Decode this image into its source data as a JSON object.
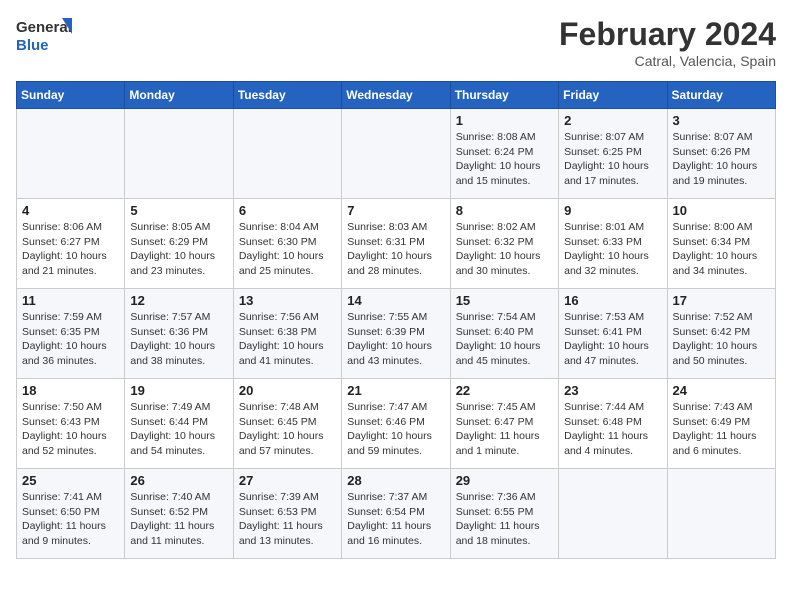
{
  "header": {
    "logo_line1": "General",
    "logo_line2": "Blue",
    "title": "February 2024",
    "subtitle": "Catral, Valencia, Spain"
  },
  "days_of_week": [
    "Sunday",
    "Monday",
    "Tuesday",
    "Wednesday",
    "Thursday",
    "Friday",
    "Saturday"
  ],
  "weeks": [
    [
      {
        "num": "",
        "content": ""
      },
      {
        "num": "",
        "content": ""
      },
      {
        "num": "",
        "content": ""
      },
      {
        "num": "",
        "content": ""
      },
      {
        "num": "1",
        "content": "Sunrise: 8:08 AM\nSunset: 6:24 PM\nDaylight: 10 hours\nand 15 minutes."
      },
      {
        "num": "2",
        "content": "Sunrise: 8:07 AM\nSunset: 6:25 PM\nDaylight: 10 hours\nand 17 minutes."
      },
      {
        "num": "3",
        "content": "Sunrise: 8:07 AM\nSunset: 6:26 PM\nDaylight: 10 hours\nand 19 minutes."
      }
    ],
    [
      {
        "num": "4",
        "content": "Sunrise: 8:06 AM\nSunset: 6:27 PM\nDaylight: 10 hours\nand 21 minutes."
      },
      {
        "num": "5",
        "content": "Sunrise: 8:05 AM\nSunset: 6:29 PM\nDaylight: 10 hours\nand 23 minutes."
      },
      {
        "num": "6",
        "content": "Sunrise: 8:04 AM\nSunset: 6:30 PM\nDaylight: 10 hours\nand 25 minutes."
      },
      {
        "num": "7",
        "content": "Sunrise: 8:03 AM\nSunset: 6:31 PM\nDaylight: 10 hours\nand 28 minutes."
      },
      {
        "num": "8",
        "content": "Sunrise: 8:02 AM\nSunset: 6:32 PM\nDaylight: 10 hours\nand 30 minutes."
      },
      {
        "num": "9",
        "content": "Sunrise: 8:01 AM\nSunset: 6:33 PM\nDaylight: 10 hours\nand 32 minutes."
      },
      {
        "num": "10",
        "content": "Sunrise: 8:00 AM\nSunset: 6:34 PM\nDaylight: 10 hours\nand 34 minutes."
      }
    ],
    [
      {
        "num": "11",
        "content": "Sunrise: 7:59 AM\nSunset: 6:35 PM\nDaylight: 10 hours\nand 36 minutes."
      },
      {
        "num": "12",
        "content": "Sunrise: 7:57 AM\nSunset: 6:36 PM\nDaylight: 10 hours\nand 38 minutes."
      },
      {
        "num": "13",
        "content": "Sunrise: 7:56 AM\nSunset: 6:38 PM\nDaylight: 10 hours\nand 41 minutes."
      },
      {
        "num": "14",
        "content": "Sunrise: 7:55 AM\nSunset: 6:39 PM\nDaylight: 10 hours\nand 43 minutes."
      },
      {
        "num": "15",
        "content": "Sunrise: 7:54 AM\nSunset: 6:40 PM\nDaylight: 10 hours\nand 45 minutes."
      },
      {
        "num": "16",
        "content": "Sunrise: 7:53 AM\nSunset: 6:41 PM\nDaylight: 10 hours\nand 47 minutes."
      },
      {
        "num": "17",
        "content": "Sunrise: 7:52 AM\nSunset: 6:42 PM\nDaylight: 10 hours\nand 50 minutes."
      }
    ],
    [
      {
        "num": "18",
        "content": "Sunrise: 7:50 AM\nSunset: 6:43 PM\nDaylight: 10 hours\nand 52 minutes."
      },
      {
        "num": "19",
        "content": "Sunrise: 7:49 AM\nSunset: 6:44 PM\nDaylight: 10 hours\nand 54 minutes."
      },
      {
        "num": "20",
        "content": "Sunrise: 7:48 AM\nSunset: 6:45 PM\nDaylight: 10 hours\nand 57 minutes."
      },
      {
        "num": "21",
        "content": "Sunrise: 7:47 AM\nSunset: 6:46 PM\nDaylight: 10 hours\nand 59 minutes."
      },
      {
        "num": "22",
        "content": "Sunrise: 7:45 AM\nSunset: 6:47 PM\nDaylight: 11 hours\nand 1 minute."
      },
      {
        "num": "23",
        "content": "Sunrise: 7:44 AM\nSunset: 6:48 PM\nDaylight: 11 hours\nand 4 minutes."
      },
      {
        "num": "24",
        "content": "Sunrise: 7:43 AM\nSunset: 6:49 PM\nDaylight: 11 hours\nand 6 minutes."
      }
    ],
    [
      {
        "num": "25",
        "content": "Sunrise: 7:41 AM\nSunset: 6:50 PM\nDaylight: 11 hours\nand 9 minutes."
      },
      {
        "num": "26",
        "content": "Sunrise: 7:40 AM\nSunset: 6:52 PM\nDaylight: 11 hours\nand 11 minutes."
      },
      {
        "num": "27",
        "content": "Sunrise: 7:39 AM\nSunset: 6:53 PM\nDaylight: 11 hours\nand 13 minutes."
      },
      {
        "num": "28",
        "content": "Sunrise: 7:37 AM\nSunset: 6:54 PM\nDaylight: 11 hours\nand 16 minutes."
      },
      {
        "num": "29",
        "content": "Sunrise: 7:36 AM\nSunset: 6:55 PM\nDaylight: 11 hours\nand 18 minutes."
      },
      {
        "num": "",
        "content": ""
      },
      {
        "num": "",
        "content": ""
      }
    ]
  ]
}
